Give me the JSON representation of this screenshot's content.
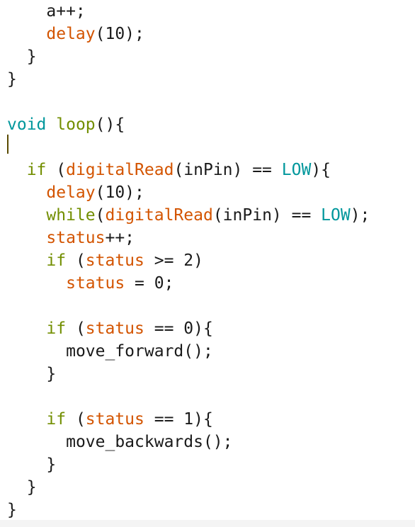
{
  "editor": {
    "lines": [
      [
        {
          "t": "    ",
          "c": "plain"
        },
        {
          "t": "a++;",
          "c": "plain"
        }
      ],
      [
        {
          "t": "    ",
          "c": "plain"
        },
        {
          "t": "delay",
          "c": "fn"
        },
        {
          "t": "(10);",
          "c": "plain"
        }
      ],
      [
        {
          "t": "  }",
          "c": "plain"
        }
      ],
      [
        {
          "t": "}",
          "c": "plain"
        }
      ],
      [],
      [
        {
          "t": "void",
          "c": "kw-type"
        },
        {
          "t": " ",
          "c": "plain"
        },
        {
          "t": "loop",
          "c": "kw-ctrl"
        },
        {
          "t": "(){",
          "c": "plain"
        }
      ],
      [],
      [
        {
          "t": "  ",
          "c": "plain"
        },
        {
          "t": "if",
          "c": "kw-ctrl"
        },
        {
          "t": " (",
          "c": "plain"
        },
        {
          "t": "digitalRead",
          "c": "fn"
        },
        {
          "t": "(inPin) == ",
          "c": "plain"
        },
        {
          "t": "LOW",
          "c": "kw-type"
        },
        {
          "t": "){",
          "c": "plain"
        }
      ],
      [
        {
          "t": "    ",
          "c": "plain"
        },
        {
          "t": "delay",
          "c": "fn"
        },
        {
          "t": "(10);",
          "c": "plain"
        }
      ],
      [
        {
          "t": "    ",
          "c": "plain"
        },
        {
          "t": "while",
          "c": "kw-ctrl"
        },
        {
          "t": "(",
          "c": "plain"
        },
        {
          "t": "digitalRead",
          "c": "fn"
        },
        {
          "t": "(inPin) == ",
          "c": "plain"
        },
        {
          "t": "LOW",
          "c": "kw-type"
        },
        {
          "t": ");",
          "c": "plain"
        }
      ],
      [
        {
          "t": "    ",
          "c": "plain"
        },
        {
          "t": "status",
          "c": "fn"
        },
        {
          "t": "++;",
          "c": "plain"
        }
      ],
      [
        {
          "t": "    ",
          "c": "plain"
        },
        {
          "t": "if",
          "c": "kw-ctrl"
        },
        {
          "t": " (",
          "c": "plain"
        },
        {
          "t": "status",
          "c": "fn"
        },
        {
          "t": " >= 2)",
          "c": "plain"
        }
      ],
      [
        {
          "t": "      ",
          "c": "plain"
        },
        {
          "t": "status",
          "c": "fn"
        },
        {
          "t": " = 0;",
          "c": "plain"
        }
      ],
      [],
      [
        {
          "t": "    ",
          "c": "plain"
        },
        {
          "t": "if",
          "c": "kw-ctrl"
        },
        {
          "t": " (",
          "c": "plain"
        },
        {
          "t": "status",
          "c": "fn"
        },
        {
          "t": " == 0){",
          "c": "plain"
        }
      ],
      [
        {
          "t": "      ",
          "c": "plain"
        },
        {
          "t": "move_forward();",
          "c": "plain"
        }
      ],
      [
        {
          "t": "    }",
          "c": "plain"
        }
      ],
      [],
      [
        {
          "t": "    ",
          "c": "plain"
        },
        {
          "t": "if",
          "c": "kw-ctrl"
        },
        {
          "t": " (",
          "c": "plain"
        },
        {
          "t": "status",
          "c": "fn"
        },
        {
          "t": " == 1){",
          "c": "plain"
        }
      ],
      [
        {
          "t": "      ",
          "c": "plain"
        },
        {
          "t": "move_backwards();",
          "c": "plain"
        }
      ],
      [
        {
          "t": "    }",
          "c": "plain"
        }
      ],
      [
        {
          "t": "  }",
          "c": "plain"
        }
      ],
      [
        {
          "t": "}",
          "c": "plain"
        }
      ]
    ]
  },
  "colors": {
    "keyword_control": "#728e00",
    "keyword_type": "#00979c",
    "function_name": "#d35400",
    "plain_text": "#1a1a1a",
    "background": "#ffffff"
  }
}
